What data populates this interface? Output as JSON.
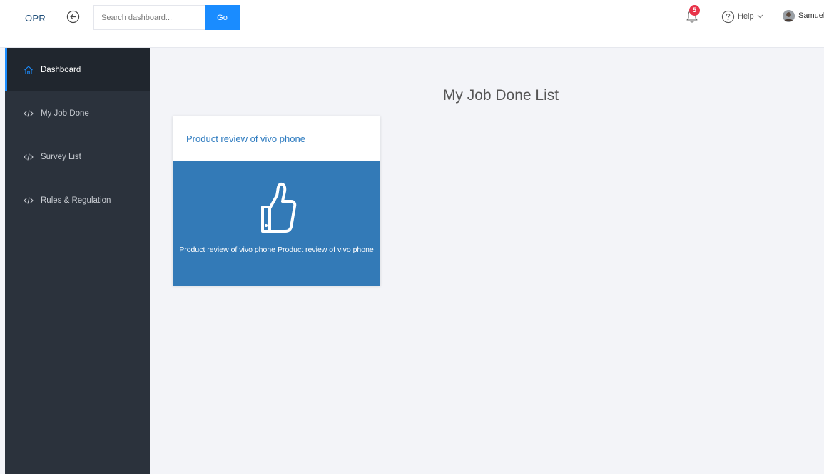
{
  "header": {
    "logo": "OPR",
    "search_placeholder": "Search dashboard...",
    "go_label": "Go",
    "notification_count": "5",
    "help_label": "Help",
    "user_name": "Samuel"
  },
  "sidebar": {
    "items": [
      {
        "label": "Dashboard",
        "icon": "home-icon",
        "active": true
      },
      {
        "label": "My Job Done",
        "icon": "code-icon"
      },
      {
        "label": "Survey List",
        "icon": "code-icon"
      },
      {
        "label": "Rules & Regulation",
        "icon": "code-icon"
      }
    ]
  },
  "main": {
    "title": "My Job Done List",
    "cards": [
      {
        "title": "Product review of vivo phone",
        "icon": "thumbs-up-icon",
        "text": "Product review of vivo phone Product review of vivo phone"
      }
    ]
  },
  "colors": {
    "accent": "#1a8cff",
    "sidebar_bg": "#2b323c",
    "card_body": "#337ab7",
    "badge": "#e8344a"
  }
}
